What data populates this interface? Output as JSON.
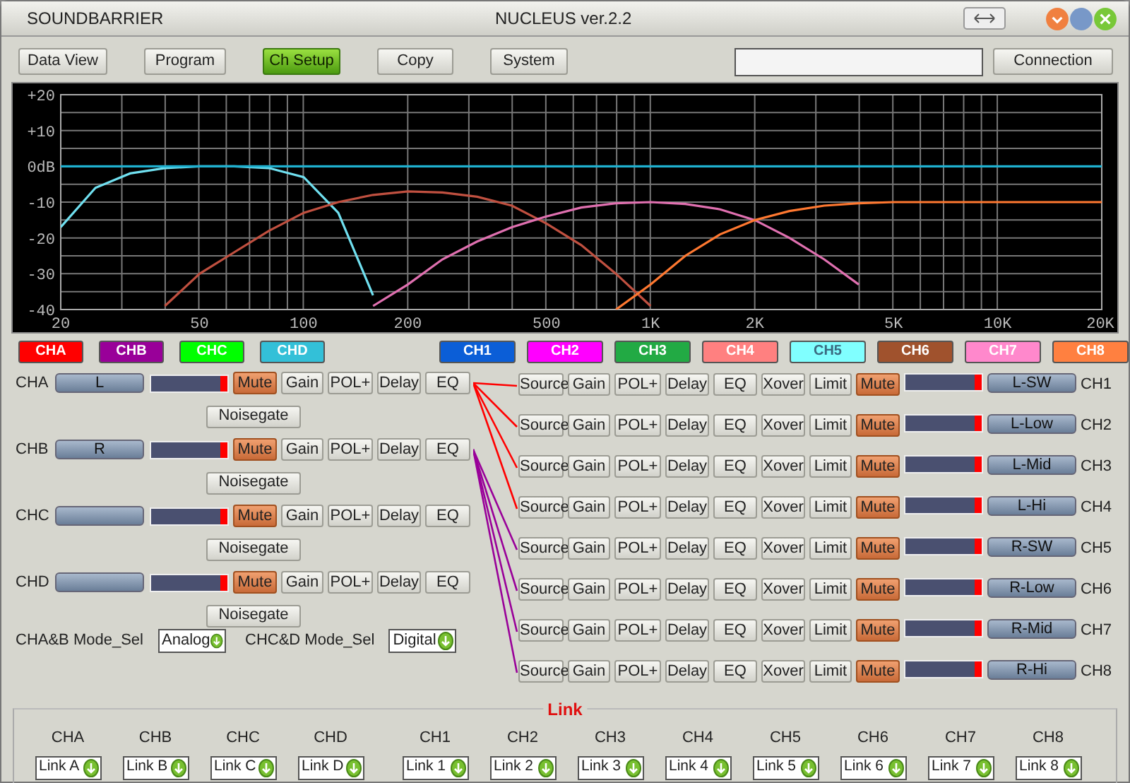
{
  "window": {
    "app_name": "SOUNDBARRIER",
    "title": "NUCLEUS ver.2.2"
  },
  "toolbar": [
    {
      "label": "Data View",
      "selected": false
    },
    {
      "label": "Program",
      "selected": false
    },
    {
      "label": "Ch Setup",
      "selected": true
    },
    {
      "label": "Copy",
      "selected": false
    },
    {
      "label": "System",
      "selected": false
    }
  ],
  "connection_button": "Connection",
  "response_chart": {
    "chart_data": {
      "type": "line",
      "categories": [
        "20",
        null,
        null,
        null,
        "50",
        null,
        null,
        "100",
        null,
        null,
        "200",
        null,
        null,
        null,
        "500",
        null,
        null,
        "1K",
        null,
        null,
        "2K",
        null,
        null,
        null,
        "5K",
        null,
        null,
        "10K",
        null,
        null,
        "20K"
      ],
      "series": [
        {
          "color": "#70e0f0",
          "values": [
            -17,
            -6,
            -2,
            -0.5,
            0,
            0,
            -0.5,
            -3,
            -13,
            -36,
            null,
            null,
            null,
            null,
            null,
            null,
            null,
            null,
            null,
            null,
            null,
            null,
            null,
            null,
            null,
            null,
            null,
            null,
            null,
            null,
            null
          ]
        },
        {
          "color": "#1fb0d0",
          "values": [
            0,
            0,
            0,
            0,
            0,
            0,
            0,
            0,
            0,
            0,
            0,
            0,
            0,
            0,
            0,
            0,
            0,
            0,
            0,
            0,
            0,
            0,
            0,
            0,
            0,
            0,
            0,
            0,
            0,
            0,
            0
          ]
        },
        {
          "color": "#c05040",
          "values": [
            null,
            null,
            null,
            -39,
            -30,
            -24,
            -18,
            -13,
            -10,
            -8,
            -7,
            -7.3,
            -8.5,
            -11,
            -16,
            -22,
            -30,
            -39,
            null,
            null,
            null,
            null,
            null,
            null,
            null,
            null,
            null,
            null,
            null,
            null,
            null
          ]
        },
        {
          "color": "#e070b0",
          "values": [
            null,
            null,
            null,
            null,
            null,
            null,
            null,
            null,
            null,
            -39,
            -33,
            -26,
            -21,
            -17,
            -14,
            -11.5,
            -10.3,
            -10,
            -10.5,
            -12,
            -15,
            -20,
            -26,
            -33,
            null,
            null,
            null,
            null,
            null,
            null,
            null
          ]
        },
        {
          "color": "#ff7830",
          "values": [
            null,
            null,
            null,
            null,
            null,
            null,
            null,
            null,
            null,
            null,
            null,
            null,
            null,
            null,
            null,
            null,
            -40,
            -33,
            -25,
            -19,
            -15,
            -12.5,
            -11,
            -10.3,
            -10,
            -10,
            -10,
            -10,
            -10,
            -10,
            -10
          ]
        }
      ],
      "ylim": [
        -40,
        20
      ],
      "grid": true,
      "yticks": [
        {
          "value": 20,
          "label": "+20"
        },
        {
          "value": 10,
          "label": "+10"
        },
        {
          "value": 0,
          "label": "0dB"
        },
        -10,
        -20,
        -30,
        -40
      ]
    }
  },
  "input_swatches": [
    {
      "label": "CHA",
      "color": "#ff0000"
    },
    {
      "label": "CHB",
      "color": "#990099"
    },
    {
      "label": "CHC",
      "color": "#00ff00"
    },
    {
      "label": "CHD",
      "color": "#33c0d8"
    }
  ],
  "output_swatches": [
    {
      "label": "CH1",
      "color": "#0b5ed7"
    },
    {
      "label": "CH2",
      "color": "#ff00ff"
    },
    {
      "label": "CH3",
      "color": "#22aa44"
    },
    {
      "label": "CH4",
      "color": "#ff8080"
    },
    {
      "label": "CH5",
      "color": "#80ffff"
    },
    {
      "label": "CH6",
      "color": "#a0522d"
    },
    {
      "label": "CH7",
      "color": "#ff88cc"
    },
    {
      "label": "CH8",
      "color": "#ff8040"
    }
  ],
  "inputs": [
    {
      "label": "CHA",
      "name": "L",
      "buttons": [
        "Mute",
        "Gain",
        "POL+",
        "Delay",
        "EQ"
      ],
      "mute_on": true,
      "noisegate": "Noisegate"
    },
    {
      "label": "CHB",
      "name": "R",
      "buttons": [
        "Mute",
        "Gain",
        "POL+",
        "Delay",
        "EQ"
      ],
      "mute_on": true,
      "noisegate": "Noisegate"
    },
    {
      "label": "CHC",
      "buttons": [
        "Mute",
        "Gain",
        "POL+",
        "Delay",
        "EQ"
      ],
      "mute_on": true,
      "noisegate": "Noisegate"
    },
    {
      "label": "CHD",
      "buttons": [
        "Mute",
        "Gain",
        "POL+",
        "Delay",
        "EQ"
      ],
      "mute_on": true,
      "noisegate": "Noisegate"
    }
  ],
  "mode_selects": [
    {
      "label": "CHA&B Mode_Sel",
      "value": "Analog"
    },
    {
      "label": "CHC&D Mode_Sel",
      "value": "Digital"
    }
  ],
  "outputs": [
    {
      "label": "CH1",
      "name": "L-SW",
      "kind": "link_a",
      "color": "#ff0000",
      "buttons": [
        "Source",
        "Gain",
        "POL+",
        "Delay",
        "EQ",
        "Xover",
        "Limit",
        "Mute"
      ],
      "mute_on": true
    },
    {
      "label": "CH2",
      "name": "L-Low",
      "kind": "link_a",
      "color": "#ff0000",
      "buttons": [
        "Source",
        "Gain",
        "POL+",
        "Delay",
        "EQ",
        "Xover",
        "Limit",
        "Mute"
      ],
      "mute_on": true
    },
    {
      "label": "CH3",
      "name": "L-Mid",
      "kind": "link_a",
      "color": "#ff0000",
      "buttons": [
        "Source",
        "Gain",
        "POL+",
        "Delay",
        "EQ",
        "Xover",
        "Limit",
        "Mute"
      ],
      "mute_on": true
    },
    {
      "label": "CH4",
      "name": "L-Hi",
      "kind": "link_a",
      "color": "#ff0000",
      "buttons": [
        "Source",
        "Gain",
        "POL+",
        "Delay",
        "EQ",
        "Xover",
        "Limit",
        "Mute"
      ],
      "mute_on": true
    },
    {
      "label": "CH5",
      "name": "R-SW",
      "kind": "link_b",
      "color": "#990099",
      "buttons": [
        "Source",
        "Gain",
        "POL+",
        "Delay",
        "EQ",
        "Xover",
        "Limit",
        "Mute"
      ],
      "mute_on": true
    },
    {
      "label": "CH6",
      "name": "R-Low",
      "kind": "link_b",
      "color": "#990099",
      "buttons": [
        "Source",
        "Gain",
        "POL+",
        "Delay",
        "EQ",
        "Xover",
        "Limit",
        "Mute"
      ],
      "mute_on": true
    },
    {
      "label": "CH7",
      "name": "R-Mid",
      "kind": "link_b",
      "color": "#990099",
      "buttons": [
        "Source",
        "Gain",
        "POL+",
        "Delay",
        "EQ",
        "Xover",
        "Limit",
        "Mute"
      ],
      "mute_on": true
    },
    {
      "label": "CH8",
      "name": "R-Hi",
      "kind": "link_b",
      "color": "#990099",
      "buttons": [
        "Source",
        "Gain",
        "POL+",
        "Delay",
        "EQ",
        "Xover",
        "Limit",
        "Mute"
      ],
      "mute_on": true
    }
  ],
  "link_panel": {
    "title": "Link",
    "links": [
      {
        "label": "CHA",
        "value": "Link A"
      },
      {
        "label": "CHB",
        "value": "Link B"
      },
      {
        "label": "CHC",
        "value": "Link C"
      },
      {
        "label": "CHD",
        "value": "Link D"
      },
      {
        "label": "CH1",
        "value": "Link 1"
      },
      {
        "label": "CH2",
        "value": "Link 2"
      },
      {
        "label": "CH3",
        "value": "Link 3"
      },
      {
        "label": "CH4",
        "value": "Link 4"
      },
      {
        "label": "CH5",
        "value": "Link 5"
      },
      {
        "label": "CH6",
        "value": "Link 6"
      },
      {
        "label": "CH7",
        "value": "Link 7"
      },
      {
        "label": "CH8",
        "value": "Link 8"
      }
    ]
  }
}
